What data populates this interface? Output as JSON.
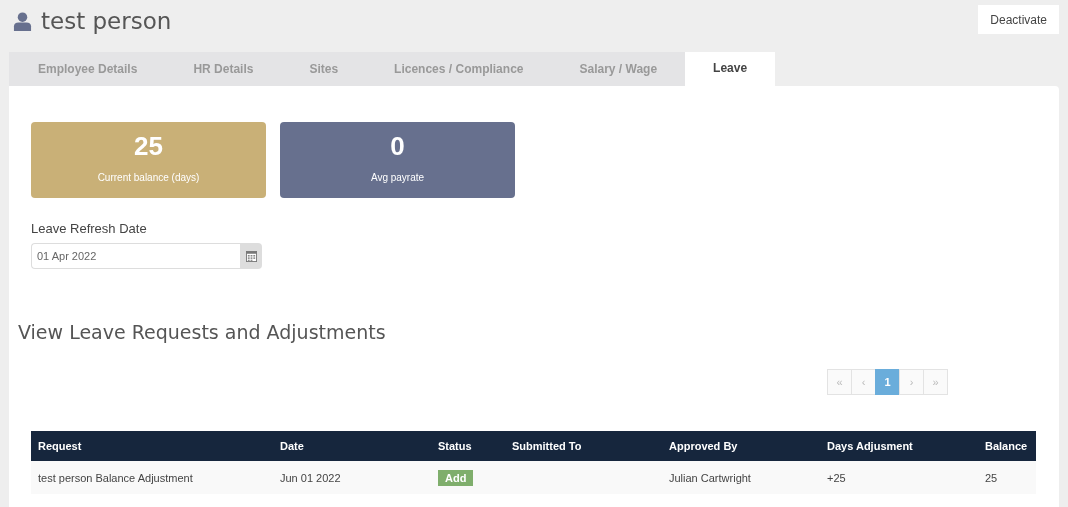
{
  "header": {
    "title": "test person",
    "action": "Deactivate"
  },
  "tabs": [
    {
      "label": "Employee Details",
      "selected": false
    },
    {
      "label": "HR Details",
      "selected": false
    },
    {
      "label": "Sites",
      "selected": false
    },
    {
      "label": "Licences / Compliance",
      "selected": false
    },
    {
      "label": "Salary / Wage",
      "selected": false
    },
    {
      "label": "Leave",
      "selected": true
    }
  ],
  "stats": [
    {
      "value": "25",
      "label": "Current balance (days)",
      "color": "#c9b077"
    },
    {
      "value": "0",
      "label": "Avg payrate",
      "color": "#67708e"
    }
  ],
  "refresh_date": {
    "label": "Leave Refresh Date",
    "value": "01 Apr 2022"
  },
  "section_title": "View Leave Requests and Adjustments",
  "pagination": [
    {
      "label": "«",
      "selected": false
    },
    {
      "label": "‹",
      "selected": false
    },
    {
      "label": "1",
      "selected": true
    },
    {
      "label": "›",
      "selected": false
    },
    {
      "label": "»",
      "selected": false
    }
  ],
  "table": {
    "columns": [
      "Request",
      "Date",
      "Status",
      "Submitted To",
      "Approved By",
      "Days Adjusment",
      "Balance"
    ],
    "rows": [
      {
        "request": "test person Balance Adjustment",
        "date": "Jun 01 2022",
        "status": "Add",
        "submitted_to": "",
        "approved_by": "Julian Cartwright",
        "days_adjustment": "+25",
        "balance": "25"
      }
    ]
  }
}
